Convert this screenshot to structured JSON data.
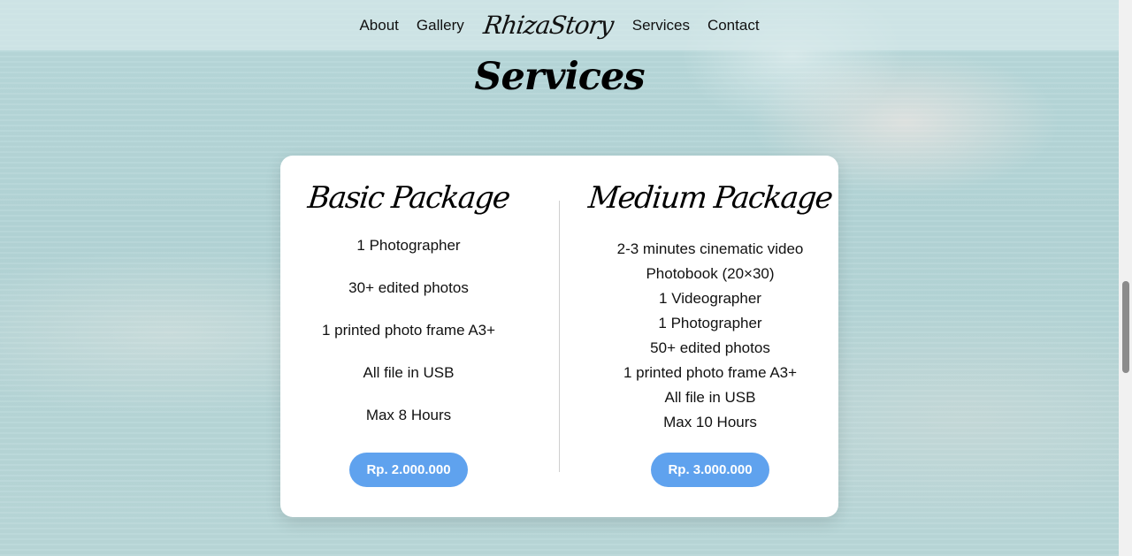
{
  "nav": {
    "about": "About",
    "gallery": "Gallery",
    "brand": "RhizaStory",
    "services": "Services",
    "contact": "Contact"
  },
  "section": {
    "title": "Services"
  },
  "packages": [
    {
      "title": "Basic Package",
      "features": [
        "1 Photographer",
        "30+ edited photos",
        "1 printed photo frame A3+",
        "All file in USB",
        "Max 8 Hours"
      ],
      "price": "Rp. 2.000.000"
    },
    {
      "title": "Medium Package",
      "features": [
        "2-3 minutes cinematic video",
        "Photobook (20×30)",
        "1 Videographer",
        "1 Photographer",
        "50+ edited photos",
        "1 printed photo frame A3+",
        "All file in USB",
        "Max 10 Hours"
      ],
      "price": "Rp. 3.000.000"
    }
  ],
  "colors": {
    "accent": "#5fa2ee",
    "background": "#b8d8da",
    "card": "#ffffff"
  }
}
